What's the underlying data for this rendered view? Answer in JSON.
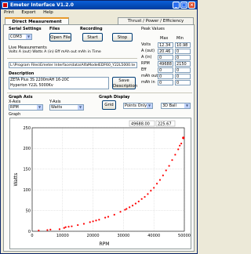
{
  "window": {
    "title": "Emeter Interface V1.2.0"
  },
  "menu": [
    "Print",
    "Export",
    "Help"
  ],
  "tabs": [
    {
      "label": "Direct Measurement"
    },
    {
      "label": "Thrust / Power / Efficiency"
    }
  ],
  "serial": {
    "heading": "Serial Settings",
    "port": "COM3"
  },
  "files": {
    "heading": "Files",
    "open_label": "Open File"
  },
  "recording": {
    "heading": "Recording",
    "start_label": "Start",
    "stop_label": "Stop"
  },
  "peak": {
    "heading": "Peak Values",
    "max_header": "Max",
    "min_header": "Min",
    "rows": [
      {
        "label": "Volts",
        "max": "12.34",
        "min": "10.98"
      },
      {
        "label": "A (out)",
        "max": "20.46",
        "min": "0"
      },
      {
        "label": "A (in)",
        "max": "0",
        "min": "0"
      },
      {
        "label": "RPM",
        "max": "49688",
        "min": "2150"
      },
      {
        "label": "Eff",
        "max": "0",
        "min": "0"
      },
      {
        "label": "mAh out",
        "max": "0",
        "min": "0"
      },
      {
        "label": "mAh in",
        "max": "0",
        "min": "0"
      }
    ]
  },
  "live": {
    "heading": "Live Measurements",
    "columns": "Volts  A (out) Watts  A (in)    Eff    mAh out  mAh in   Time"
  },
  "file_path": "L:\\Program Files\\Emeter Interface\\data\\AlfaModelEDF60_Y22L5000.te",
  "description": {
    "heading": "Description",
    "text_line1": "ZETA Plus 3S 2200mAH 16-20C",
    "text_line2": "Hyperion Y22L 5000Kv",
    "save_label_line1": "Save",
    "save_label_line2": "Description"
  },
  "graph_axis": {
    "heading": "Graph Axis",
    "x_label": "X-Axis",
    "x_value": "RPM",
    "y_label": "Y-Axis",
    "y_value": "Watts"
  },
  "graph_display": {
    "heading": "Graph Display",
    "grid_label": "Grid",
    "mode_value": "Points Only",
    "view_value": "3D Ball"
  },
  "graph": {
    "heading": "Graph",
    "cursor_x": "49688.00",
    "cursor_y": "225.67"
  },
  "chart_data": {
    "type": "scatter",
    "xlabel": "RPM",
    "ylabel": "Watts",
    "xlim": [
      0,
      50000
    ],
    "ylim": [
      0,
      250
    ],
    "x_ticks": [
      "0",
      "10000",
      "20000",
      "30000",
      "40000",
      "50000"
    ],
    "y_ticks": [
      "0",
      "50",
      "100",
      "150",
      "200",
      "250"
    ],
    "grid": true,
    "series_color": "#ff0000",
    "points": [
      [
        2150,
        2
      ],
      [
        5000,
        3
      ],
      [
        6000,
        4
      ],
      [
        9000,
        5
      ],
      [
        10500,
        8
      ],
      [
        11000,
        10
      ],
      [
        12000,
        11
      ],
      [
        13000,
        12
      ],
      [
        15000,
        15
      ],
      [
        17000,
        18
      ],
      [
        19000,
        22
      ],
      [
        20000,
        24
      ],
      [
        21000,
        26
      ],
      [
        22000,
        28
      ],
      [
        24000,
        33
      ],
      [
        25000,
        35
      ],
      [
        27000,
        40
      ],
      [
        29000,
        47
      ],
      [
        30500,
        52
      ],
      [
        31000,
        54
      ],
      [
        32000,
        58
      ],
      [
        33000,
        62
      ],
      [
        34000,
        67
      ],
      [
        35000,
        72
      ],
      [
        36000,
        78
      ],
      [
        37000,
        83
      ],
      [
        38000,
        90
      ],
      [
        39000,
        98
      ],
      [
        40000,
        105
      ],
      [
        41000,
        115
      ],
      [
        42000,
        124
      ],
      [
        43000,
        135
      ],
      [
        44000,
        147
      ],
      [
        45000,
        158
      ],
      [
        46000,
        172
      ],
      [
        47000,
        185
      ],
      [
        48000,
        198
      ],
      [
        48500,
        207
      ],
      [
        49000,
        212
      ],
      [
        49688,
        225.67
      ]
    ]
  }
}
